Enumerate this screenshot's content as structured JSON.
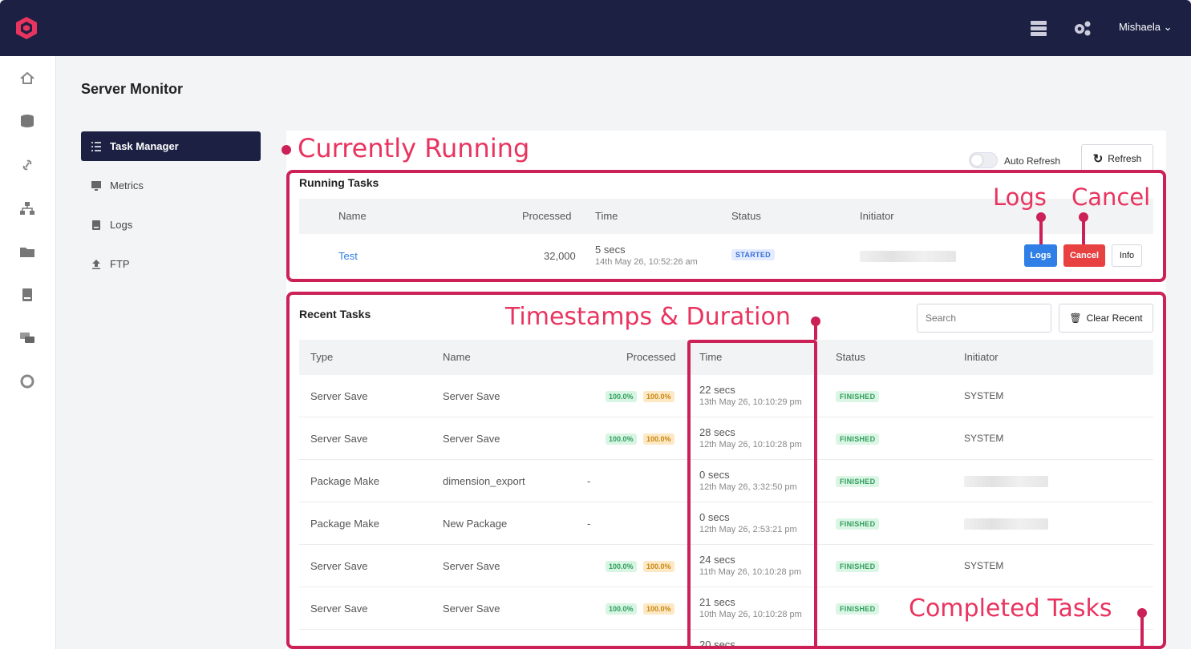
{
  "header": {
    "user_name": "Mishaela",
    "icons": [
      "server-icon",
      "settings-gears-icon"
    ]
  },
  "sidebar": {
    "icons": [
      "home-icon",
      "database-icon",
      "link-icon",
      "network-icon",
      "folder-icon",
      "book-icon",
      "chat-icon",
      "lifebuoy-icon"
    ]
  },
  "page": {
    "title": "Server Monitor"
  },
  "menu": [
    {
      "label": "Task Manager",
      "icon": "task-list-icon",
      "active": true
    },
    {
      "label": "Metrics",
      "icon": "monitor-icon"
    },
    {
      "label": "Logs",
      "icon": "book-icon"
    },
    {
      "label": "FTP",
      "icon": "upload-icon"
    }
  ],
  "controls": {
    "auto_refresh_label": "Auto Refresh",
    "auto_refresh_on": false,
    "refresh_label": "Refresh"
  },
  "running": {
    "title": "Running Tasks",
    "columns": [
      "Name",
      "Processed",
      "Time",
      "Status",
      "Initiator"
    ],
    "rows": [
      {
        "name": "Test",
        "processed": "32,000",
        "duration": "5 secs",
        "timestamp": "14th May 26, 10:52:26 am",
        "status": "STARTED"
      }
    ],
    "actions": {
      "logs": "Logs",
      "cancel": "Cancel",
      "info": "Info"
    }
  },
  "recent": {
    "title": "Recent Tasks",
    "search_placeholder": "Search",
    "clear_label": "Clear Recent",
    "columns": [
      "Type",
      "Name",
      "Processed",
      "Time",
      "Status",
      "Initiator"
    ],
    "rows": [
      {
        "type": "Server Save",
        "name": "Server Save",
        "p1": "100.0%",
        "p2": "100.0%",
        "duration": "22 secs",
        "timestamp": "13th May 26, 10:10:29 pm",
        "status": "FINISHED",
        "initiator": "SYSTEM"
      },
      {
        "type": "Server Save",
        "name": "Server Save",
        "p1": "100.0%",
        "p2": "100.0%",
        "duration": "28 secs",
        "timestamp": "12th May 26, 10:10:28 pm",
        "status": "FINISHED",
        "initiator": "SYSTEM"
      },
      {
        "type": "Package Make",
        "name": "dimension_export",
        "processed": "-",
        "duration": "0 secs",
        "timestamp": "12th May 26, 3:32:50 pm",
        "status": "FINISHED"
      },
      {
        "type": "Package Make",
        "name": "New Package",
        "processed": "-",
        "duration": "0 secs",
        "timestamp": "12th May 26, 2:53:21 pm",
        "status": "FINISHED"
      },
      {
        "type": "Server Save",
        "name": "Server Save",
        "p1": "100.0%",
        "p2": "100.0%",
        "duration": "24 secs",
        "timestamp": "11th May 26, 10:10:28 pm",
        "status": "FINISHED",
        "initiator": "SYSTEM"
      },
      {
        "type": "Server Save",
        "name": "Server Save",
        "p1": "100.0%",
        "p2": "100.0%",
        "duration": "21 secs",
        "timestamp": "10th May 26, 10:10:28 pm",
        "status": "FINISHED"
      },
      {
        "duration": "20 secs"
      }
    ]
  },
  "annotations": {
    "running": "Currently Running",
    "logs": "Logs",
    "cancel": "Cancel",
    "timestamps": "Timestamps & Duration",
    "completed": "Completed Tasks",
    "color": "#cc2157",
    "text_color": "#e8345f"
  },
  "colors": {
    "navy": "#1c2143",
    "primary": "#2f7fe6",
    "danger": "#e84142"
  }
}
